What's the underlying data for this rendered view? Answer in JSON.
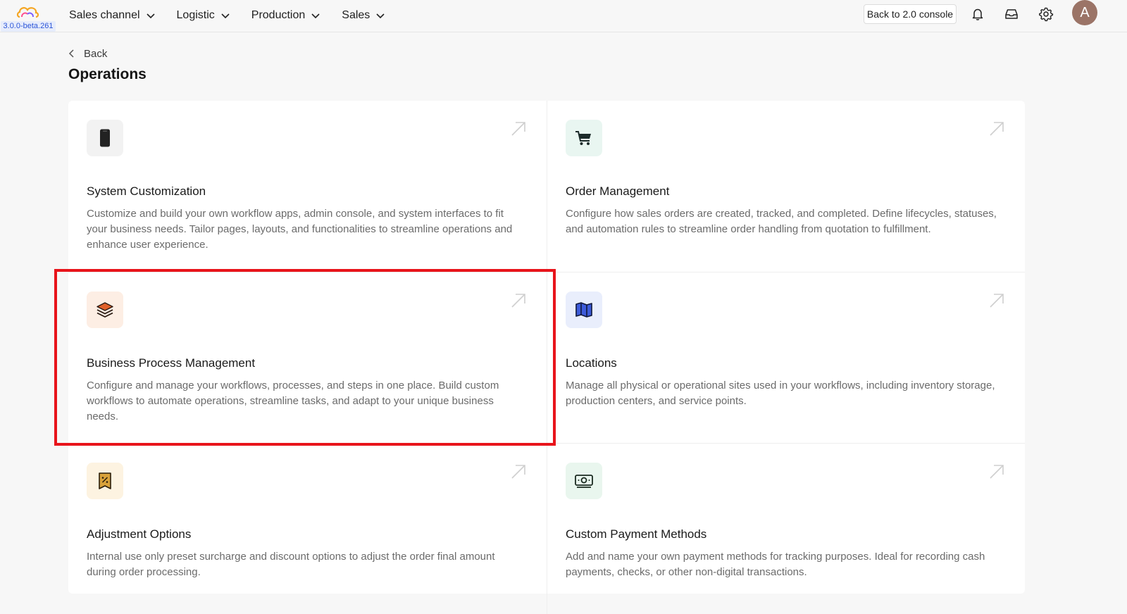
{
  "app": {
    "version": "3.0.0-beta.261",
    "logo_icon": "cloud-logo-icon"
  },
  "nav": {
    "items": [
      {
        "label": "Sales channel"
      },
      {
        "label": "Logistic"
      },
      {
        "label": "Production"
      },
      {
        "label": "Sales"
      }
    ]
  },
  "topbar": {
    "console_label": "Back to 2.0 console",
    "avatar_initial": "A"
  },
  "header": {
    "back_label": "Back",
    "title": "Operations"
  },
  "cards": [
    {
      "title": "System Customization",
      "description": "Customize and build your own workflow apps, admin console, and system interfaces to fit your business needs. Tailor pages, layouts, and functionalities to streamline operations and enhance user experience.",
      "icon": "smartphone-icon",
      "icon_bg": "#f2f2f2"
    },
    {
      "title": "Order Management",
      "description": "Configure how sales orders are created, tracked, and completed. Define lifecycles, statuses, and automation rules to streamline order handling from quotation to fulfillment.",
      "icon": "shopping-cart-icon",
      "icon_bg": "#e9f6f1"
    },
    {
      "title": "Business Process Management",
      "description": "Configure and manage your workflows, processes, and steps in one place. Build custom workflows to automate operations, streamline tasks, and adapt to your unique business needs.",
      "icon": "layers-icon",
      "icon_bg": "#fdeee4"
    },
    {
      "title": "Locations",
      "description": "Manage all physical or operational sites used in your workflows, including inventory storage, production centers, and service points.",
      "icon": "map-icon",
      "icon_bg": "#e9eefc"
    },
    {
      "title": "Adjustment Options",
      "description": "Internal use only preset surcharge and discount options to adjust the order final amount during order processing.",
      "icon": "discount-receipt-icon",
      "icon_bg": "#fdf3e1"
    },
    {
      "title": "Custom Payment Methods",
      "description": "Add and name your own payment methods for tracking purposes. Ideal for recording cash payments, checks, or other non-digital transactions.",
      "icon": "cash-icon",
      "icon_bg": "#e9f6ee"
    }
  ],
  "colors": {
    "highlight": "#e8141b",
    "accent": "#2b55d8"
  }
}
